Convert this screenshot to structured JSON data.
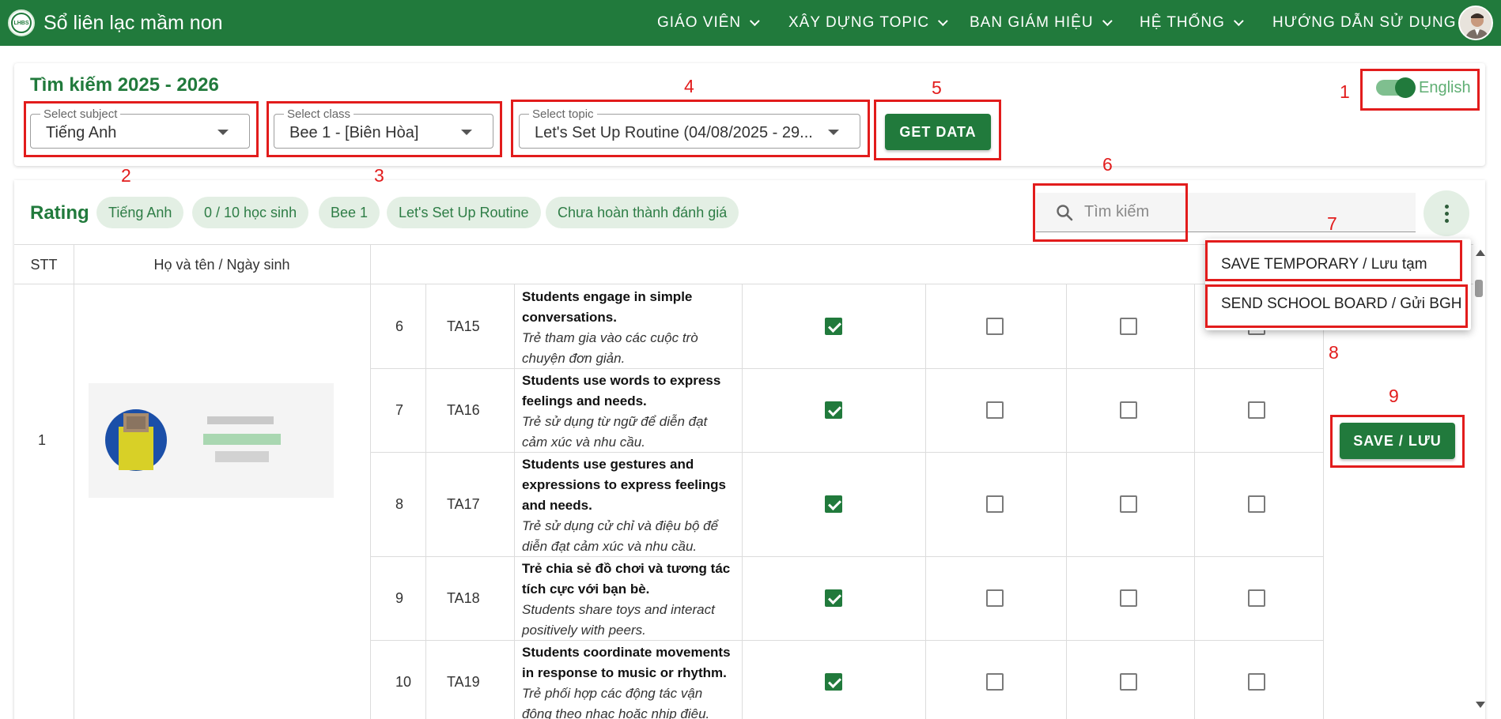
{
  "colors": {
    "brand_green": "#217a3c",
    "chip_bg": "#e3efe4",
    "annotation_red": "#e21c1c"
  },
  "app": {
    "title": "Sổ liên lạc mầm non",
    "logo_text": "LHBS"
  },
  "nav": [
    {
      "label": "GIÁO VIÊN"
    },
    {
      "label": "XÂY DỰNG TOPIC"
    },
    {
      "label": "BAN GIÁM HIỆU"
    },
    {
      "label": "HỆ THỐNG"
    },
    {
      "label": "HƯỚNG DẪN SỬ DỤNG"
    }
  ],
  "search": {
    "title": "Tìm kiếm 2025 - 2026",
    "subject": {
      "label": "Select subject",
      "value": "Tiếng Anh"
    },
    "class": {
      "label": "Select class",
      "value": "Bee 1 - [Biên Hòa]"
    },
    "topic": {
      "label": "Select topic",
      "value": "Let's Set Up Routine (04/08/2025 - 29..."
    },
    "get_data_label": "GET DATA",
    "language_label": "English",
    "language_toggle_on": true
  },
  "rating": {
    "title": "Rating",
    "chips": [
      "Tiếng Anh",
      "0 / 10 học sinh",
      "Bee 1",
      "Let's Set Up Routine",
      "Chưa hoàn thành đánh giá"
    ],
    "search_placeholder": "Tìm kiếm",
    "menu": {
      "save_temporary": "SAVE TEMPORARY / Lưu tạm",
      "send_board": "SEND SCHOOL BOARD / Gửi BGH"
    },
    "save_label": "SAVE / LƯU"
  },
  "table": {
    "headers": {
      "stt": "STT",
      "name": "Họ và tên / Ngày sinh"
    },
    "student": {
      "stt": "1"
    },
    "rows": [
      {
        "no": "6",
        "code": "TA15",
        "en": "Students engage in simple conversations.",
        "vi": "Trẻ tham gia vào các cuộc trò chuyện đơn giản.",
        "checks": [
          true,
          false,
          false,
          false
        ]
      },
      {
        "no": "7",
        "code": "TA16",
        "en": "Students use words to express feelings and needs.",
        "vi": "Trẻ sử dụng từ ngữ để diễn đạt cảm xúc và nhu cầu.",
        "checks": [
          true,
          false,
          false,
          false
        ]
      },
      {
        "no": "8",
        "code": "TA17",
        "en": "Students use gestures and expressions to express feelings and needs.",
        "vi": "Trẻ sử dụng cử chỉ và điệu bộ để diễn đạt cảm xúc và nhu cầu.",
        "checks": [
          true,
          false,
          false,
          false
        ]
      },
      {
        "no": "9",
        "code": "TA18",
        "en": "Trẻ chia sẻ đồ chơi và tương tác tích cực với bạn bè.",
        "vi": "Students share toys and interact positively with peers.",
        "checks": [
          true,
          false,
          false,
          false
        ]
      },
      {
        "no": "10",
        "code": "TA19",
        "en": "Students coordinate movements in response to music or rhythm.",
        "vi": "Trẻ phối hợp các động tác vận động theo nhạc hoặc nhịp điệu.",
        "checks": [
          true,
          false,
          false,
          false
        ]
      }
    ]
  },
  "annotations": [
    "1",
    "2",
    "3",
    "4",
    "5",
    "6",
    "7",
    "8",
    "9"
  ]
}
